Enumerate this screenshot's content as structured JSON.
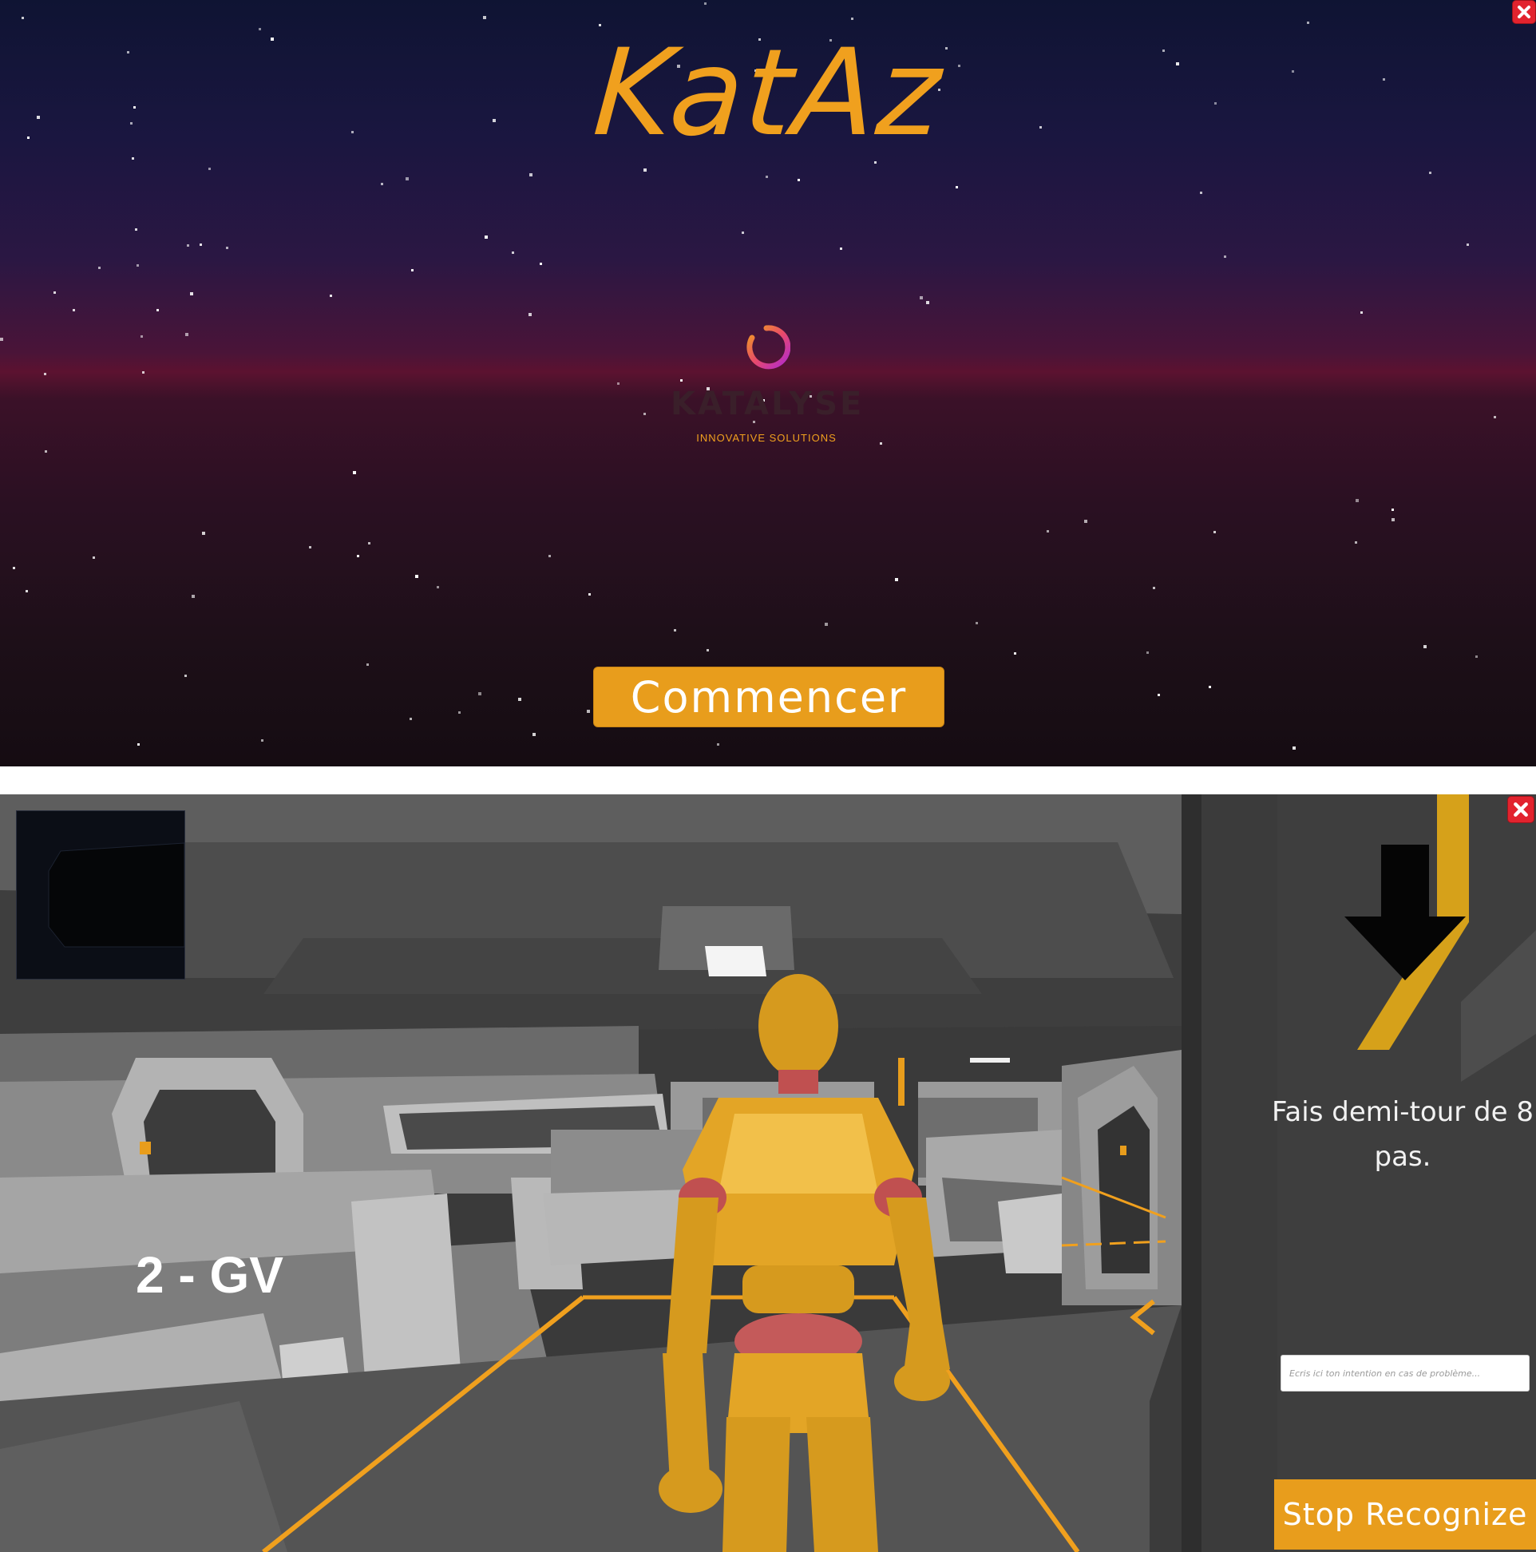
{
  "title_screen": {
    "title": "KatAz",
    "logo": {
      "name": "KATALYSE",
      "tagline": "INNOVATIVE SOLUTIONS"
    },
    "start_button_label": "Commencer",
    "close_icon": "close-icon"
  },
  "game_screen": {
    "room_label": "2 - GV",
    "instruction": "Fais demi-tour de 8 pas.",
    "direction_icon": "arrow-down-icon",
    "intent_input": {
      "placeholder": "Ecris ici ton intention en cas de problème...",
      "value": ""
    },
    "stop_button_label": "Stop Recognize",
    "close_icon": "close-icon"
  },
  "colors": {
    "accent": "#e89d1c",
    "title_orange": "#f0a01e",
    "close_red": "#e2232e"
  }
}
